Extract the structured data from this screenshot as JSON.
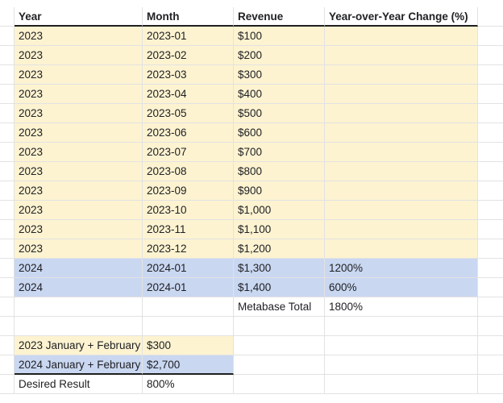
{
  "headers": [
    "Year",
    "Month",
    "Revenue",
    "Year-over-Year Change (%)"
  ],
  "rows": [
    {
      "year": "2023",
      "month": "2023-01",
      "revenue": "$100",
      "yoy": "",
      "color": "yellow"
    },
    {
      "year": "2023",
      "month": "2023-02",
      "revenue": "$200",
      "yoy": "",
      "color": "yellow"
    },
    {
      "year": "2023",
      "month": "2023-03",
      "revenue": "$300",
      "yoy": "",
      "color": "yellow"
    },
    {
      "year": "2023",
      "month": "2023-04",
      "revenue": "$400",
      "yoy": "",
      "color": "yellow"
    },
    {
      "year": "2023",
      "month": "2023-05",
      "revenue": "$500",
      "yoy": "",
      "color": "yellow"
    },
    {
      "year": "2023",
      "month": "2023-06",
      "revenue": "$600",
      "yoy": "",
      "color": "yellow"
    },
    {
      "year": "2023",
      "month": "2023-07",
      "revenue": "$700",
      "yoy": "",
      "color": "yellow"
    },
    {
      "year": "2023",
      "month": "2023-08",
      "revenue": "$800",
      "yoy": "",
      "color": "yellow"
    },
    {
      "year": "2023",
      "month": "2023-09",
      "revenue": "$900",
      "yoy": "",
      "color": "yellow"
    },
    {
      "year": "2023",
      "month": "2023-10",
      "revenue": "$1,000",
      "yoy": "",
      "color": "yellow"
    },
    {
      "year": "2023",
      "month": "2023-11",
      "revenue": "$1,100",
      "yoy": "",
      "color": "yellow"
    },
    {
      "year": "2023",
      "month": "2023-12",
      "revenue": "$1,200",
      "yoy": "",
      "color": "yellow"
    },
    {
      "year": "2024",
      "month": "2024-01",
      "revenue": "$1,300",
      "yoy": "1200%",
      "color": "blue"
    },
    {
      "year": "2024",
      "month": "2024-01",
      "revenue": "$1,400",
      "yoy": "600%",
      "color": "blue"
    }
  ],
  "total_row": {
    "label": "Metabase Total",
    "value": "1800%"
  },
  "summary": [
    {
      "label": "2023 January + February",
      "value": "$300",
      "color": "yellow"
    },
    {
      "label": "2024 January + February",
      "value": "$2,700",
      "color": "blue"
    },
    {
      "label": "Desired Result",
      "value": "800%",
      "color": ""
    }
  ],
  "colors": {
    "yellow": "#fdf3d1",
    "blue": "#c9d7f1",
    "grid_line": "#e2e2e2",
    "header_rule": "#1f1f1f"
  }
}
